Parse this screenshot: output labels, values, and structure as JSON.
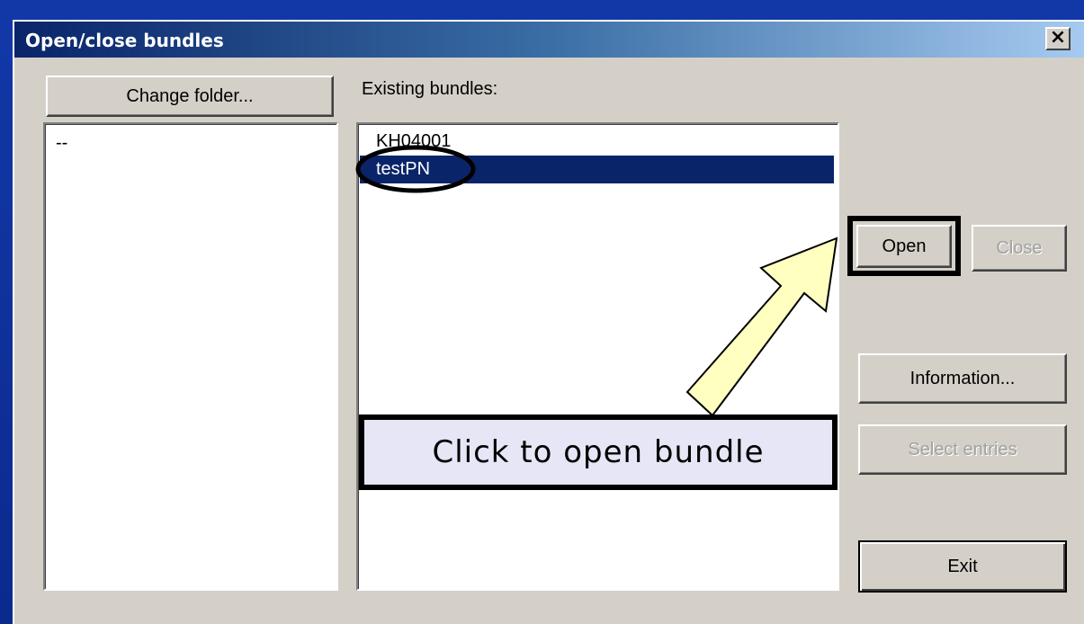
{
  "dialog": {
    "title": "Open/close bundles",
    "close_glyph": "×"
  },
  "left_panel": {
    "change_folder_label": "Change folder...",
    "folder_items": [
      "--"
    ]
  },
  "bundles": {
    "label": "Existing bundles:",
    "items": [
      "KH04001",
      "testPN"
    ],
    "selected_index": 1
  },
  "buttons": {
    "open": "Open",
    "close": "Close",
    "information": "Information...",
    "select_entries": "Select entries",
    "exit": "Exit"
  },
  "annotation": {
    "callout_text": "Click to open bundle"
  },
  "colors": {
    "selection": "#0a246a",
    "dialog_face": "#d4d0c8",
    "arrow_fill": "#ffffc0",
    "callout_fill": "#e6e6f6"
  }
}
